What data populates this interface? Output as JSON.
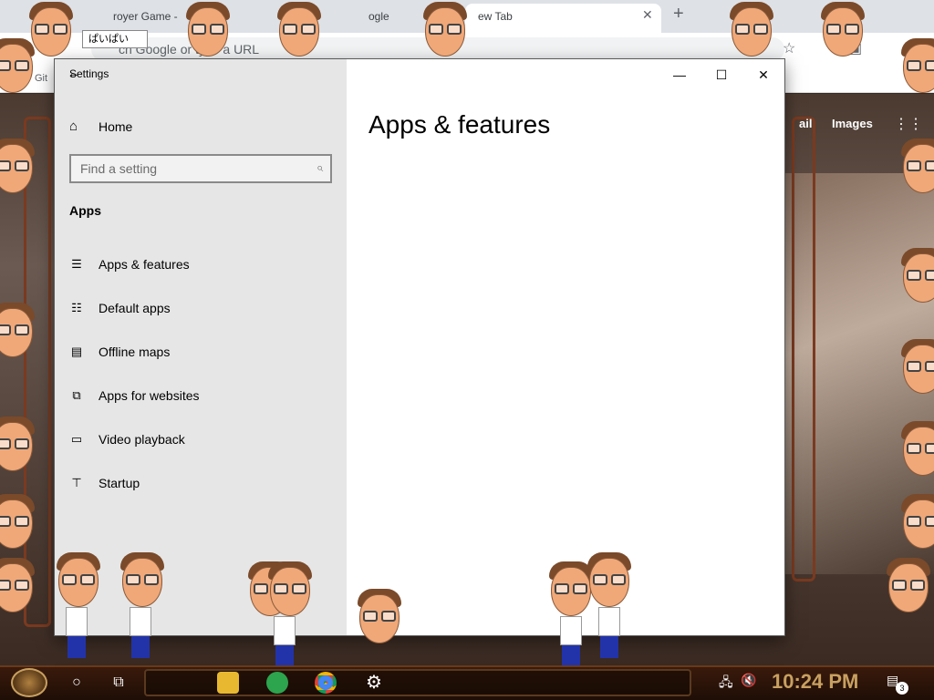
{
  "browser": {
    "tabs": [
      {
        "label": "royer Game -"
      },
      {
        "label": "ogle"
      },
      {
        "label": "ew Tab"
      }
    ],
    "omnibox_placeholder": "ch Google or type a URL",
    "bookmark_label": "Git",
    "page_links": [
      "ail",
      "Images"
    ],
    "tooltip": "ぱいぱい"
  },
  "settings": {
    "window_title": "Settings",
    "home_label": "Home",
    "search_placeholder": "Find a setting",
    "section_title": "Apps",
    "nav_items": [
      {
        "label": "Apps & features",
        "icon": "list-icon"
      },
      {
        "label": "Default apps",
        "icon": "default-apps-icon"
      },
      {
        "label": "Offline maps",
        "icon": "map-icon"
      },
      {
        "label": "Apps for websites",
        "icon": "open-in-icon"
      },
      {
        "label": "Video playback",
        "icon": "video-icon"
      },
      {
        "label": "Startup",
        "icon": "startup-icon"
      }
    ],
    "page_title": "Apps & features"
  },
  "taskbar": {
    "clock": "10:24 PM",
    "notification_count": "3",
    "pinned": [
      "file-explorer",
      "sheets",
      "chrome",
      "settings"
    ]
  },
  "colors": {
    "sidebar_bg": "#e6e6e6",
    "clock": "#c8a060"
  }
}
